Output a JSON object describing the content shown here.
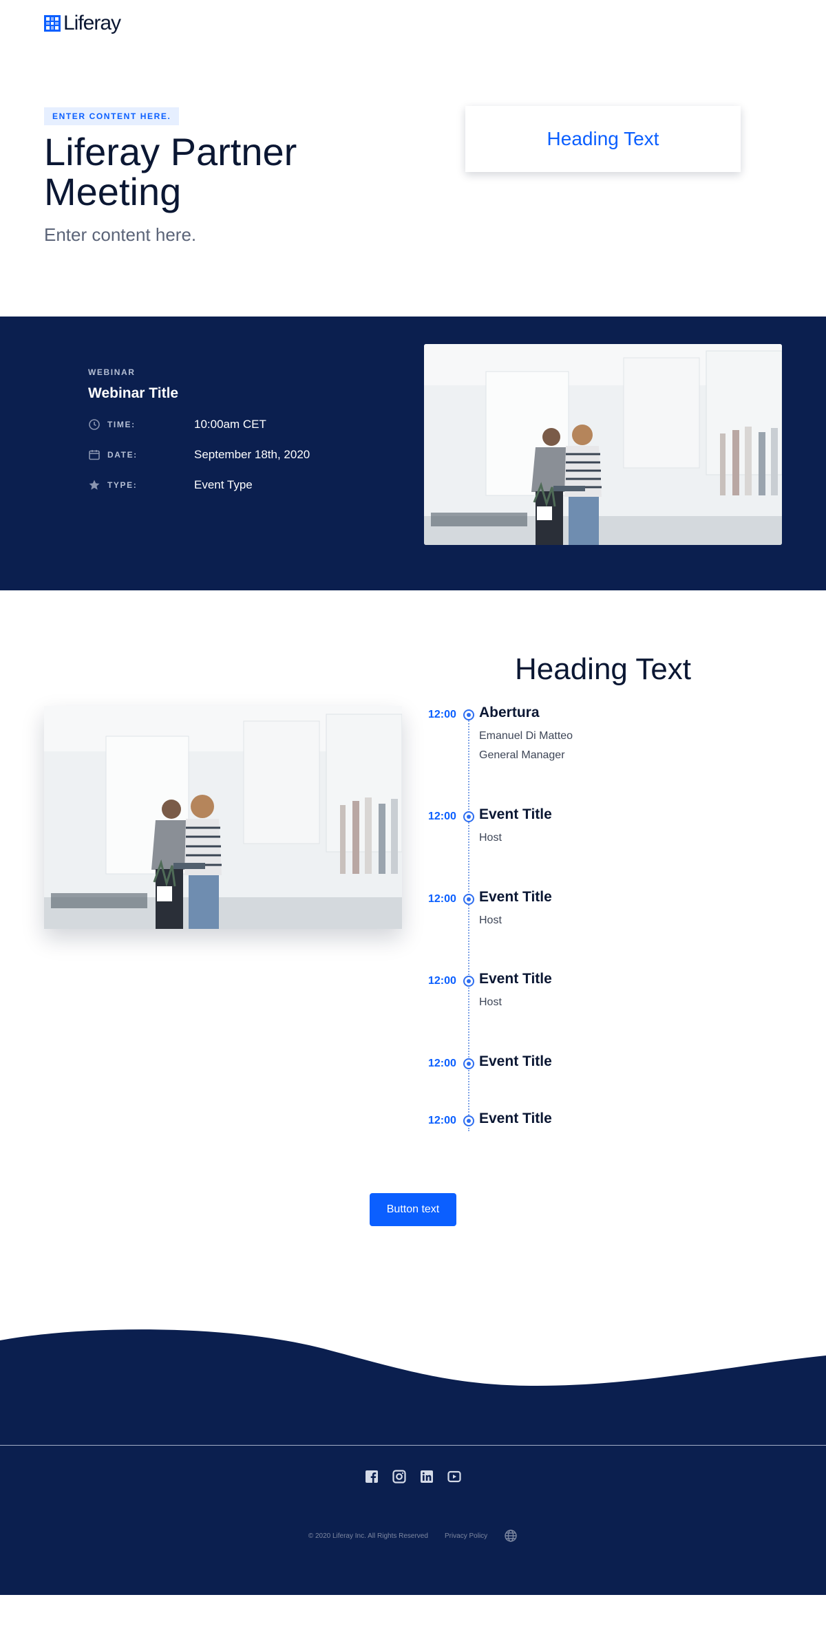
{
  "header": {
    "logo_text": "Liferay"
  },
  "hero": {
    "eyebrow": "ENTER CONTENT HERE.",
    "title": "Liferay Partner Meeting",
    "subtitle": "Enter content here.",
    "card_heading": "Heading Text"
  },
  "webinar": {
    "label": "WEBINAR",
    "title": "Webinar Title",
    "rows": [
      {
        "icon": "clock-icon",
        "label": "TIME:",
        "value": "10:00am CET"
      },
      {
        "icon": "calendar-icon",
        "label": "DATE:",
        "value": "September 18th, 2020"
      },
      {
        "icon": "star-icon",
        "label": "TYPE:",
        "value": "Event Type"
      }
    ]
  },
  "agenda": {
    "heading": "Heading Text",
    "items": [
      {
        "time": "12:00",
        "title": "Abertura",
        "lines": [
          "Emanuel Di Matteo",
          "General Manager"
        ]
      },
      {
        "time": "12:00",
        "title": "Event Title",
        "lines": [
          "Host"
        ]
      },
      {
        "time": "12:00",
        "title": "Event Title",
        "lines": [
          "Host"
        ]
      },
      {
        "time": "12:00",
        "title": "Event Title",
        "lines": [
          "Host"
        ]
      },
      {
        "time": "12:00",
        "title": "Event Title",
        "lines": []
      },
      {
        "time": "12:00",
        "title": "Event Title",
        "lines": []
      }
    ],
    "button_label": "Button text"
  },
  "footer": {
    "social": [
      "facebook-icon",
      "instagram-icon",
      "linkedin-icon",
      "youtube-icon"
    ],
    "copyright": "© 2020 Liferay Inc. All Rights Reserved",
    "privacy": "Privacy Policy",
    "language_icon": "globe-icon"
  },
  "colors": {
    "brand": "#0b5fff",
    "navy": "#0b1f4f",
    "text": "#0b1733"
  }
}
